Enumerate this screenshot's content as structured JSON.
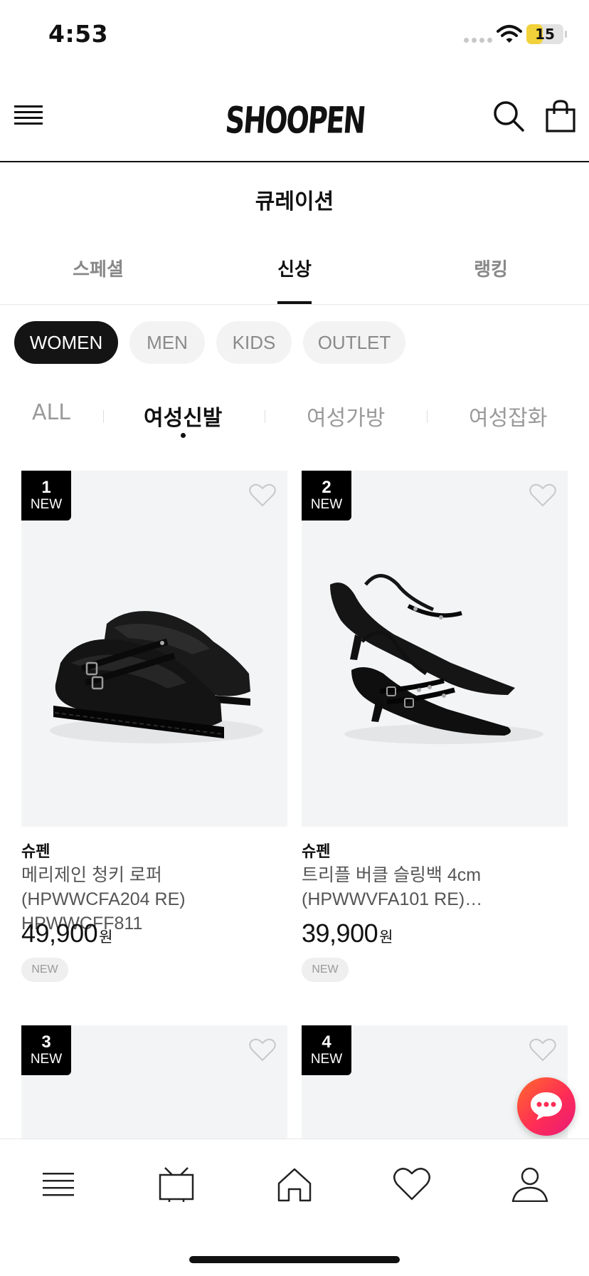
{
  "status_bar": {
    "time": "4:53",
    "battery": "15",
    "battery_level": 0.15
  },
  "header": {
    "logo_text": "SHOOPEN",
    "menu_icon": "hamburger-menu-icon",
    "search_icon": "search-icon",
    "cart_icon": "shopping-bag-icon"
  },
  "page": {
    "title": "큐레이션"
  },
  "main_tabs": [
    {
      "label": "스페셜",
      "active": false
    },
    {
      "label": "신상",
      "active": true
    },
    {
      "label": "랭킹",
      "active": false
    }
  ],
  "gender_chips": [
    {
      "label": "WOMEN",
      "active": true
    },
    {
      "label": "MEN",
      "active": false
    },
    {
      "label": "KIDS",
      "active": false
    },
    {
      "label": "OUTLET",
      "active": false
    }
  ],
  "sub_categories": [
    {
      "label": "ALL",
      "active": false
    },
    {
      "label": "여성신발",
      "active": true
    },
    {
      "label": "여성가방",
      "active": false
    },
    {
      "label": "여성잡화",
      "active": false
    }
  ],
  "products": [
    {
      "rank": "1",
      "badge": "NEW",
      "brand": "슈펜",
      "name": "메리제인 청키 로퍼 (HPWWCFA204 RE) HPWWCFF811",
      "price": "49,900",
      "currency": "원",
      "tag": "NEW",
      "image": "black-chunky-mary-jane-loafers"
    },
    {
      "rank": "2",
      "badge": "NEW",
      "brand": "슈펜",
      "name": "트리플 버클 슬링백 4cm (HPWWVFA101 RE)…",
      "price": "39,900",
      "currency": "원",
      "tag": "NEW",
      "image": "black-pointed-slingback-heels"
    },
    {
      "rank": "3",
      "badge": "NEW"
    },
    {
      "rank": "4",
      "badge": "NEW"
    }
  ],
  "bottom_nav": [
    {
      "name": "category",
      "icon": "menu-icon"
    },
    {
      "name": "live",
      "icon": "tv-icon"
    },
    {
      "name": "home",
      "icon": "home-icon"
    },
    {
      "name": "wishlist",
      "icon": "heart-icon"
    },
    {
      "name": "my-page",
      "icon": "user-icon"
    }
  ],
  "chat": {
    "icon": "chat-bubble-icon"
  },
  "colors": {
    "accent_dark": "#141414",
    "chat_gradient_start": "#ff6a2b",
    "chat_gradient_end": "#e6197a",
    "battery": "#f2d23a"
  }
}
